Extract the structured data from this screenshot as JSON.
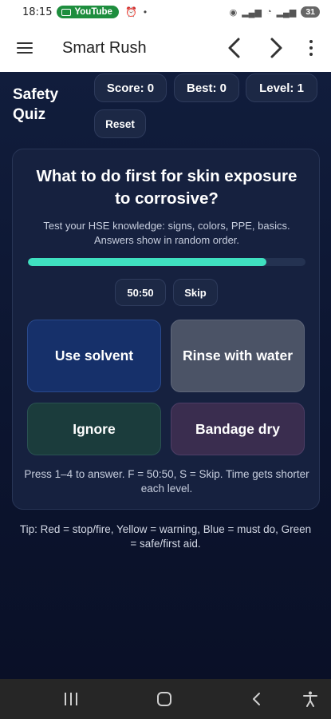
{
  "status": {
    "time": "18:15",
    "app_badge": "YouTube",
    "battery": "31"
  },
  "app_bar": {
    "title": "Smart Rush"
  },
  "quiz": {
    "title": "Safety Quiz",
    "score_label": "Score: 0",
    "best_label": "Best: 0",
    "level_label": "Level: 1",
    "reset_label": "Reset",
    "question": "What to do first for skin exposure to corrosive?",
    "subtitle": "Test your HSE knowledge: signs, colors, PPE, basics. Answers show in random order.",
    "time_remaining_fraction": 0.86,
    "fifty_label": "50:50",
    "skip_label": "Skip",
    "answers": [
      {
        "label": "Use solvent",
        "color": "#16306a"
      },
      {
        "label": "Rinse with water",
        "color": "#4b5366"
      },
      {
        "label": "Ignore",
        "color": "#1b3c3c"
      },
      {
        "label": "Bandage dry",
        "color": "#3a2d4f"
      }
    ],
    "hint": "Press 1–4 to answer. F = 50:50, S = Skip. Time gets shorter each level.",
    "tip": "Tip: Red = stop/fire, Yellow = warning, Blue = must do, Green = safe/first aid."
  },
  "colors": {
    "accent": "#3fe0c0",
    "background": "#0d1630",
    "card": "#16213f"
  },
  "icons": [
    "menu-icon",
    "arrow-left-icon",
    "arrow-right-icon",
    "more-vert-icon",
    "recent-apps-icon",
    "home-icon",
    "back-icon",
    "accessibility-icon"
  ]
}
